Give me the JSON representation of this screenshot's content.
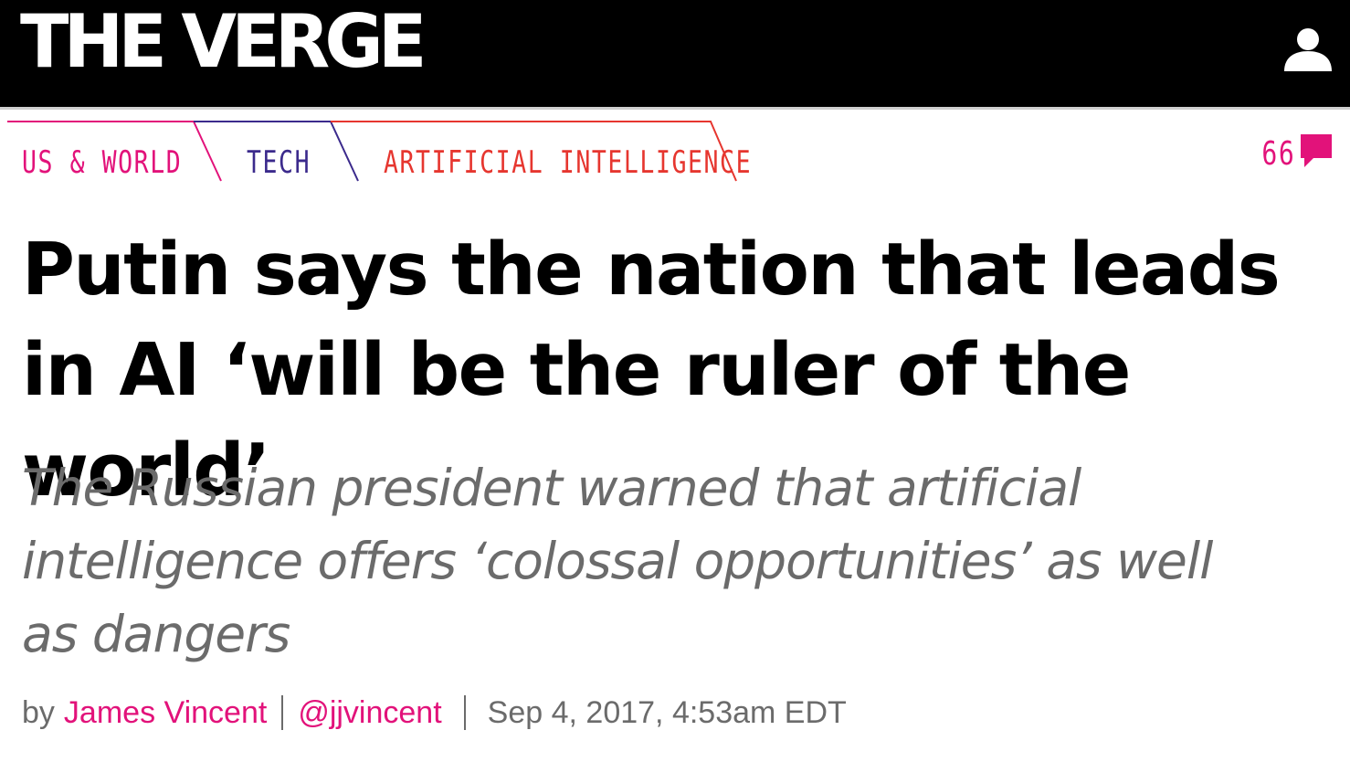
{
  "header": {
    "logo_text": "THE VERGE",
    "user_icon": "user-icon"
  },
  "categories": [
    {
      "label": "US & WORLD",
      "color": "#e2127a"
    },
    {
      "label": "TECH",
      "color": "#3b2a8c"
    },
    {
      "label": "ARTIFICIAL INTELLIGENCE",
      "color": "#e6362f"
    }
  ],
  "comments": {
    "count": "66",
    "icon": "comment-icon",
    "color": "#e2127a"
  },
  "article": {
    "headline": "Putin says the nation that leads in AI ‘will be the ruler of the world’",
    "dek": "The Russian president warned that artificial intelligence offers ‘colossal opportunities’ as well as dangers",
    "byline": {
      "prefix": "by",
      "author": "James Vincent",
      "handle": "@jjvincent",
      "date": "Sep 4, 2017, 4:53am EDT"
    }
  },
  "colors": {
    "accent": "#e2127a",
    "tech": "#3b2a8c",
    "ai": "#e6362f",
    "text_gray": "#6b6b6b"
  }
}
